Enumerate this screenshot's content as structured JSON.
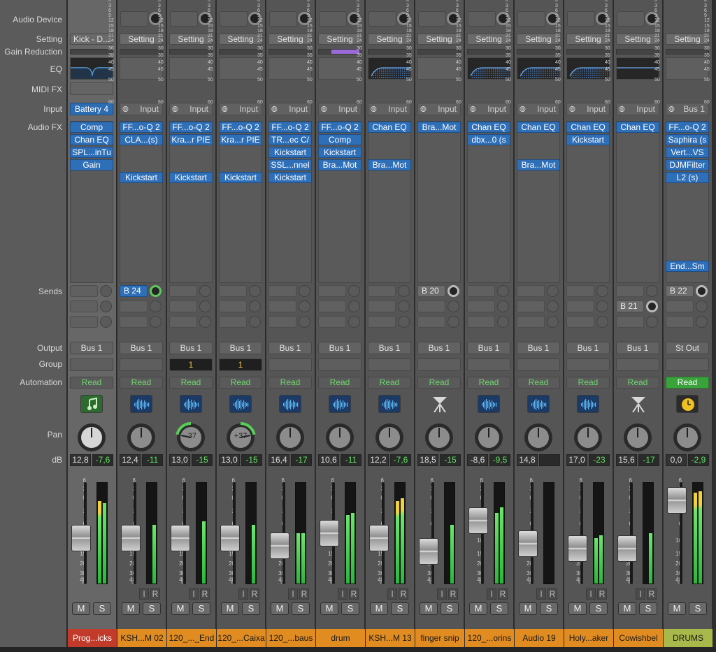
{
  "row_labels": {
    "audio_device": "Audio Device",
    "setting": "Setting",
    "gain_reduction": "Gain Reduction",
    "eq": "EQ",
    "midi_fx": "MIDI FX",
    "input": "Input",
    "audio_fx": "Audio FX",
    "sends": "Sends",
    "output": "Output",
    "group": "Group",
    "automation": "Automation",
    "pan": "Pan",
    "db": "dB"
  },
  "fader_scale": [
    "6",
    "3",
    "0",
    "3",
    "6",
    "10",
    "15",
    "20",
    "30",
    "40",
    "∞"
  ],
  "meter_scale": [
    "0",
    "3",
    "6",
    "9",
    "12",
    "15",
    "18",
    "21",
    "24",
    "30",
    "35",
    "40",
    "45",
    "50",
    "60"
  ],
  "ir_labels": {
    "i": "I",
    "r": "R"
  },
  "mute_label": "M",
  "solo_label": "S",
  "colors": {
    "plugin_blue": "#2e6fb8",
    "meter_green": "#4ccf4c",
    "automation_green": "#6fd66f",
    "track_red": "#c23a2a",
    "track_orange": "#e18c21",
    "track_olive": "#a8b84a"
  },
  "channels": [
    {
      "setting": "Kick - D...",
      "input": "Battery 4",
      "input_link": false,
      "plugins": [
        "Comp",
        "Chan EQ",
        "SPL...inTu",
        "Gain"
      ],
      "sends": [],
      "output": "Bus 1",
      "group": "",
      "automation": "Read",
      "icon": "music-note-icon",
      "pan": "",
      "db": "12,8",
      "peak": "-7,6",
      "fader": 0.55,
      "meter": [
        0.82,
        0.8
      ],
      "name": "Prog...icks",
      "color": "#c23a2a",
      "eq": "dip",
      "selected": true
    },
    {
      "setting": "Setting",
      "input": "Input",
      "input_link": true,
      "plugins": [
        "FF...o-Q 2",
        "CLA...(s)",
        "",
        "",
        "Kickstart"
      ],
      "sends": [
        {
          "label": "B 24",
          "active": "green"
        }
      ],
      "output": "Bus 1",
      "group": "",
      "automation": "Read",
      "icon": "waveform-icon",
      "pan": "",
      "db": "12,4",
      "peak": "-11",
      "fader": 0.55,
      "meter": [
        0.0,
        0.58
      ],
      "name": "KSH...M 02",
      "color": "#e18c21",
      "eq": ""
    },
    {
      "setting": "Setting",
      "input": "Input",
      "input_link": true,
      "plugins": [
        "FF...o-Q 2",
        "Kra...r PIE",
        "",
        "",
        "Kickstart"
      ],
      "sends": [],
      "output": "Bus 1",
      "group": "1",
      "automation": "Read",
      "icon": "waveform-icon",
      "pan": "-37",
      "db": "13,0",
      "peak": "-15",
      "fader": 0.55,
      "meter": [
        0.0,
        0.62
      ],
      "name": "120_..._End",
      "color": "#e18c21",
      "eq": ""
    },
    {
      "setting": "Setting",
      "input": "Input",
      "input_link": true,
      "plugins": [
        "FF...o-Q 2",
        "Kra...r PIE",
        "",
        "",
        "Kickstart"
      ],
      "sends": [],
      "output": "Bus 1",
      "group": "1",
      "automation": "Read",
      "icon": "waveform-icon",
      "pan": "+37",
      "db": "13,0",
      "peak": "-15",
      "fader": 0.55,
      "meter": [
        0.0,
        0.58
      ],
      "name": "120_...Caixa",
      "color": "#e18c21",
      "eq": ""
    },
    {
      "setting": "Setting",
      "input": "Input",
      "input_link": true,
      "plugins": [
        "FF...o-Q 2",
        "TR...ec C/",
        "Kickstart",
        "SSL...nnel",
        "Kickstart"
      ],
      "sends": [],
      "output": "Bus 1",
      "group": "",
      "automation": "Read",
      "icon": "waveform-icon",
      "pan": "",
      "db": "16,4",
      "peak": "-17",
      "fader": 0.62,
      "meter": [
        0.5,
        0.5
      ],
      "name": "120_...baus",
      "color": "#e18c21",
      "eq": ""
    },
    {
      "setting": "Setting",
      "input": "Input",
      "input_link": true,
      "plugins": [
        "FF...o-Q 2",
        "Comp",
        "Kickstart",
        "Bra...Mot"
      ],
      "sends": [],
      "output": "Bus 1",
      "group": "",
      "automation": "Read",
      "icon": "waveform-icon",
      "pan": "",
      "db": "10,6",
      "peak": "-11",
      "fader": 0.5,
      "meter": [
        0.68,
        0.7
      ],
      "name": "drum",
      "color": "#e18c21",
      "eq": "",
      "gr": true
    },
    {
      "setting": "Setting",
      "input": "Input",
      "input_link": true,
      "plugins": [
        "Chan EQ",
        "",
        "",
        "Bra...Mot"
      ],
      "sends": [],
      "output": "Bus 1",
      "group": "",
      "automation": "Read",
      "icon": "waveform-icon",
      "pan": "",
      "db": "12,2",
      "peak": "-7,6",
      "fader": 0.55,
      "meter": [
        0.82,
        0.85
      ],
      "name": "KSH...M 13",
      "color": "#e18c21",
      "eq": "shelf"
    },
    {
      "setting": "Setting",
      "input": "Input",
      "input_link": true,
      "plugins": [
        "Bra...Mot"
      ],
      "sends": [
        {
          "label": "B 20",
          "active": "gray"
        }
      ],
      "output": "Bus 1",
      "group": "",
      "automation": "Read",
      "icon": "stand-icon",
      "pan": "",
      "db": "18,5",
      "peak": "-15",
      "fader": 0.68,
      "meter": [
        0.0,
        0.58
      ],
      "name": "finger snip",
      "color": "#e18c21",
      "eq": ""
    },
    {
      "setting": "Setting",
      "input": "Input",
      "input_link": true,
      "plugins": [
        "Chan EQ",
        "dbx...0 (s"
      ],
      "sends": [],
      "output": "Bus 1",
      "group": "",
      "automation": "Read",
      "icon": "waveform-icon",
      "pan": "",
      "db": "-8,6",
      "peak": "-9,5",
      "fader": 0.38,
      "meter": [
        0.7,
        0.76
      ],
      "name": "120_...orins",
      "color": "#e18c21",
      "eq": "shelf"
    },
    {
      "setting": "Setting",
      "input": "Input",
      "input_link": true,
      "plugins": [
        "Chan EQ",
        "",
        "",
        "Bra...Mot"
      ],
      "sends": [],
      "output": "Bus 1",
      "group": "",
      "automation": "Read",
      "icon": "waveform-icon",
      "pan": "",
      "db": "14,8",
      "peak": "",
      "fader": 0.6,
      "meter": [
        0.0,
        0.0
      ],
      "name": "Audio 19",
      "color": "#e18c21",
      "eq": "shelf"
    },
    {
      "setting": "Setting",
      "input": "Input",
      "input_link": true,
      "plugins": [
        "Chan EQ",
        "Kickstart"
      ],
      "sends": [],
      "output": "Bus 1",
      "group": "",
      "automation": "Read",
      "icon": "waveform-icon",
      "pan": "",
      "db": "17,0",
      "peak": "-23",
      "fader": 0.65,
      "meter": [
        0.45,
        0.48
      ],
      "name": "Holy...aker",
      "color": "#e18c21",
      "eq": "shelf"
    },
    {
      "setting": "Setting",
      "input": "Input",
      "input_link": true,
      "plugins": [
        "Chan EQ"
      ],
      "sends": [
        {
          "label": "",
          "active": ""
        },
        {
          "label": "B 21",
          "active": "gray"
        }
      ],
      "output": "Bus 1",
      "group": "",
      "automation": "Read",
      "icon": "stand-icon",
      "pan": "",
      "db": "15,6",
      "peak": "-17",
      "fader": 0.65,
      "meter": [
        0.0,
        0.5
      ],
      "name": "Cowishbel",
      "color": "#e18c21",
      "eq": "flat"
    },
    {
      "setting": "Setting",
      "input": "Bus 1",
      "input_link": true,
      "plugins": [
        "FF...o-Q 2",
        "Saphira (s",
        "Vert...VS",
        "DJMFilter",
        "L2 (s)"
      ],
      "last_plugin": "End...Sm",
      "sends": [
        {
          "label": "B 22",
          "active": "gray"
        }
      ],
      "output": "St Out",
      "group": "",
      "automation": "Read",
      "icon": "clock-icon",
      "pan": "",
      "db": "0,0",
      "peak": "-2,9",
      "fader": 0.18,
      "meter": [
        0.9,
        0.92
      ],
      "name": "DRUMS",
      "color": "#a8b84a",
      "eq": "",
      "auto_on": true
    }
  ]
}
